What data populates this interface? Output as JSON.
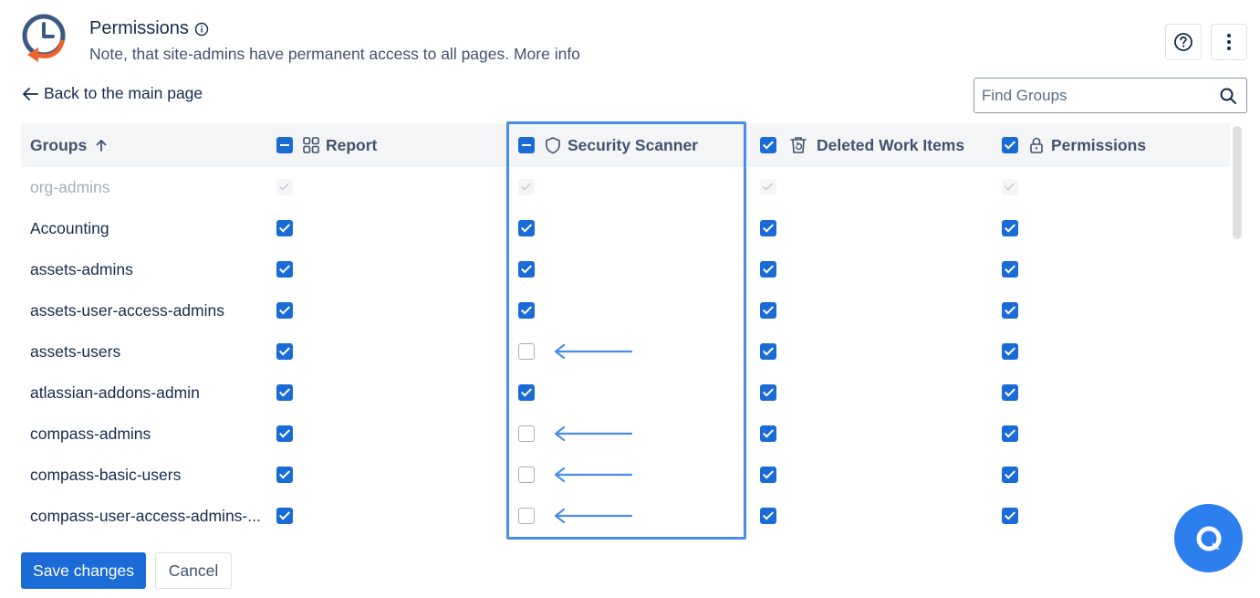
{
  "header": {
    "title": "Permissions",
    "subtitle": "Note, that site-admins have permanent access to all pages. More info"
  },
  "nav": {
    "back_label": "Back to the main page"
  },
  "search": {
    "placeholder": "Find Groups"
  },
  "table": {
    "columns": [
      {
        "label": "Groups",
        "sort": "ascending",
        "icon": "sort-up-icon"
      },
      {
        "label": "Report",
        "icon": "grid-icon",
        "header_state": "indeterminate"
      },
      {
        "label": "Security Scanner",
        "icon": "shield-icon",
        "header_state": "indeterminate",
        "highlighted": true
      },
      {
        "label": "Deleted Work Items",
        "icon": "trash-icon",
        "header_state": "checked"
      },
      {
        "label": "Permissions",
        "icon": "lock-icon",
        "header_state": "checked"
      }
    ],
    "rows": [
      {
        "group": "org-admins",
        "disabled": true,
        "report": true,
        "security_scanner": true,
        "deleted_work_items": true,
        "permissions": true
      },
      {
        "group": "Accounting",
        "report": true,
        "security_scanner": true,
        "deleted_work_items": true,
        "permissions": true
      },
      {
        "group": "assets-admins",
        "report": true,
        "security_scanner": true,
        "deleted_work_items": true,
        "permissions": true
      },
      {
        "group": "assets-user-access-admins",
        "report": true,
        "security_scanner": true,
        "deleted_work_items": true,
        "permissions": true
      },
      {
        "group": "assets-users",
        "report": true,
        "security_scanner": false,
        "deleted_work_items": true,
        "permissions": true,
        "annotated": true
      },
      {
        "group": "atlassian-addons-admin",
        "report": true,
        "security_scanner": true,
        "deleted_work_items": true,
        "permissions": true
      },
      {
        "group": "compass-admins",
        "report": true,
        "security_scanner": false,
        "deleted_work_items": true,
        "permissions": true,
        "annotated": true
      },
      {
        "group": "compass-basic-users",
        "report": true,
        "security_scanner": false,
        "deleted_work_items": true,
        "permissions": true,
        "annotated": true
      },
      {
        "group": "compass-user-access-admins-...",
        "report": true,
        "security_scanner": false,
        "deleted_work_items": true,
        "permissions": true,
        "annotated": true
      }
    ]
  },
  "footer": {
    "save_label": "Save changes",
    "cancel_label": "Cancel"
  },
  "colors": {
    "accent": "#1a6bd6",
    "highlight": "#4a8de8",
    "fab": "#2d7ff0",
    "logo_blue": "#3c5a80",
    "logo_orange": "#f0622d"
  }
}
